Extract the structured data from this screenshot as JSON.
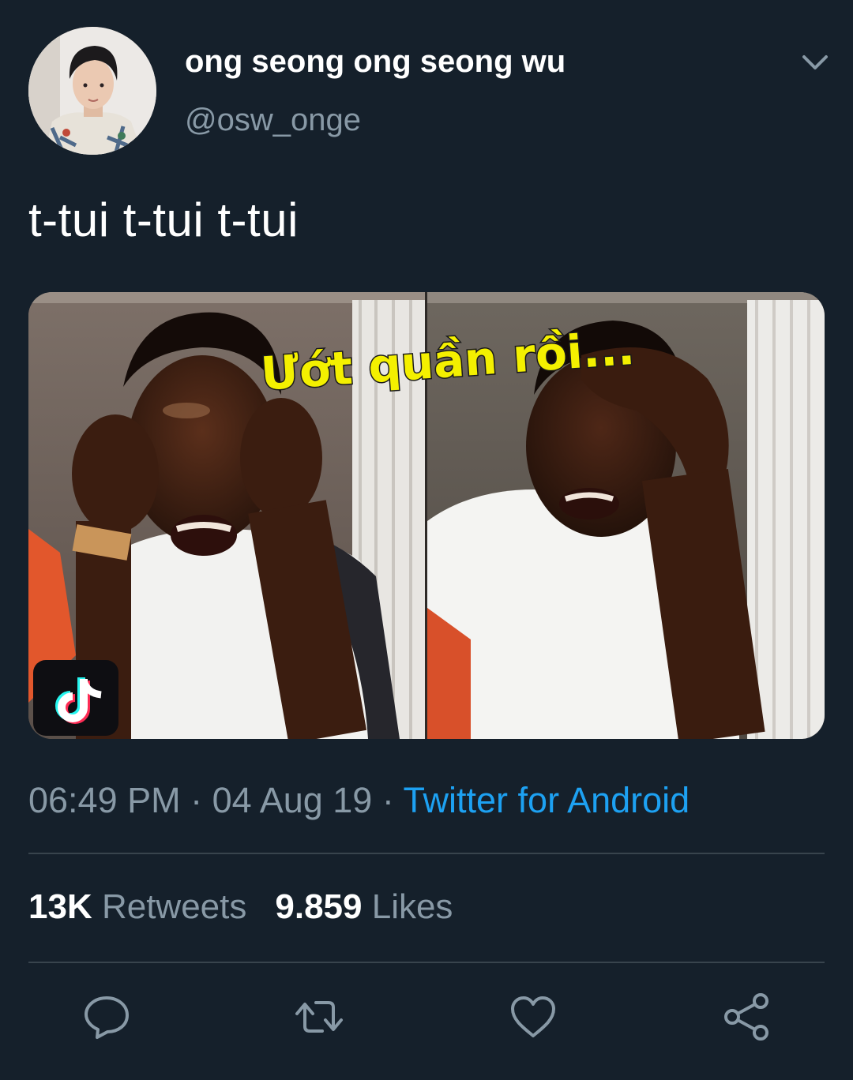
{
  "tweet": {
    "display_name": "ong seong ong seong wu",
    "handle": "@osw_onge",
    "text": "t-tui t-tui t-tui",
    "media": {
      "caption": "Ướt quần rồi..."
    },
    "time": "06:49 PM",
    "separator": " · ",
    "date": "04 Aug 19",
    "source": "Twitter for Android",
    "stats": {
      "retweets_count": "13K",
      "retweets_label": "Retweets",
      "likes_count": "9.859",
      "likes_label": "Likes"
    }
  },
  "icons": {
    "more": "chevron-down-icon",
    "reply": "reply-icon",
    "retweet": "retweet-icon",
    "like": "heart-icon",
    "share": "share-icon",
    "watermark": "tiktok-logo-icon"
  },
  "colors": {
    "background": "#15202b",
    "secondary_text": "#8899a6",
    "link": "#1da1f2",
    "divider": "#38444d",
    "caption_fill": "#f4f000"
  }
}
